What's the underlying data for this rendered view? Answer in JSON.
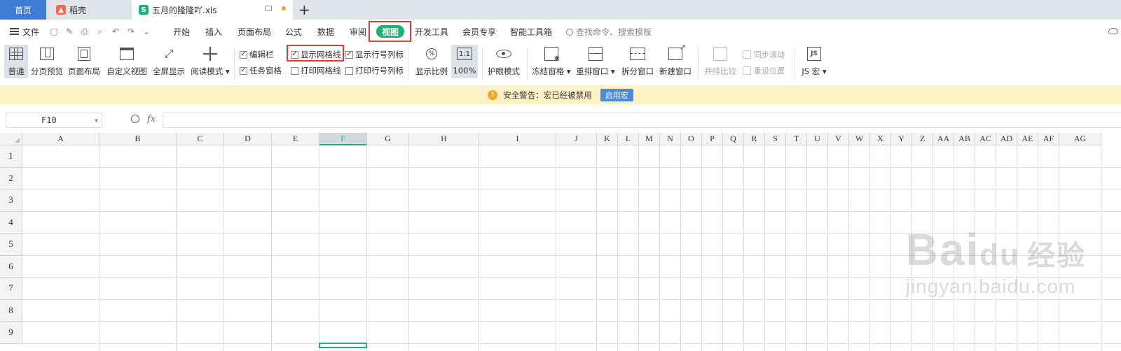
{
  "tabs": {
    "home": "首页",
    "daoke": "稻壳",
    "doc": "五月的隆隆吖.xls",
    "add": "+"
  },
  "menu": {
    "file": "文件",
    "items": [
      "开始",
      "插入",
      "页面布局",
      "公式",
      "数据",
      "审阅",
      "视图",
      "开发工具",
      "会员专享",
      "智能工具箱"
    ],
    "active": "视图",
    "search_placeholder": "查找命令、搜索模板"
  },
  "ribbon": {
    "normal": "普通",
    "page_break": "分页预览",
    "page_layout": "页面布局",
    "custom_view": "自定义视图",
    "full_screen": "全屏显示",
    "read_mode": "阅读模式",
    "edit_bar": "编辑栏",
    "task_pane": "任务窗格",
    "show_gridlines": "显示网格线",
    "print_gridlines": "打印网格线",
    "show_headers": "显示行号列标",
    "print_headers": "打印行号列标",
    "zoom": "显示比例",
    "zoom_100": "100%",
    "ratio_icon": "1:1",
    "eye_mode": "护眼模式",
    "freeze": "冻结窗格",
    "rearrange": "重排窗口",
    "split": "拆分窗口",
    "new_window": "新建窗口",
    "side_by_side": "并排比较",
    "sync_scroll": "同步滚动",
    "reset_pos": "重设位置",
    "js_macro": "JS 宏",
    "js_icon": "JS"
  },
  "checkbox_state": {
    "edit_bar": true,
    "task_pane": true,
    "show_gridlines": true,
    "print_gridlines": false,
    "show_headers": true,
    "print_headers": false
  },
  "banner": {
    "icon": "!",
    "text": "安全警告：宏已经被禁用",
    "button": "启用宏"
  },
  "formula_bar": {
    "cell_ref": "F10",
    "fx": "fx",
    "value": ""
  },
  "sheet": {
    "columns": [
      "A",
      "B",
      "C",
      "D",
      "E",
      "F",
      "G",
      "H",
      "I",
      "J",
      "K",
      "L",
      "M",
      "N",
      "O",
      "P",
      "Q",
      "R",
      "S",
      "T",
      "U",
      "V",
      "W",
      "X",
      "Y",
      "Z",
      "AA",
      "AB",
      "AC",
      "AD",
      "AE",
      "AF",
      "AG"
    ],
    "rows": [
      "1",
      "2",
      "3",
      "4",
      "5",
      "6",
      "7",
      "8",
      "9"
    ],
    "selected_column": "F"
  },
  "watermark": {
    "brand": "Bai",
    "brand2": "du",
    "brand_cn": "经验",
    "url": "jingyan.baidu.com"
  },
  "colors": {
    "accent": "#1fb076",
    "home_tab": "#3d7bd6",
    "highlight": "#e53935",
    "banner_bg": "#fdf1c8"
  }
}
